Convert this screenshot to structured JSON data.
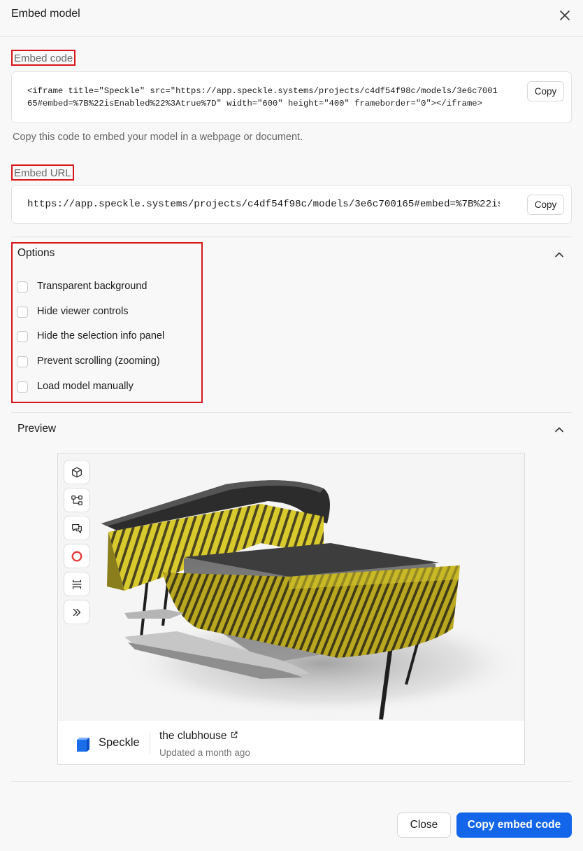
{
  "dialog": {
    "title": "Embed model"
  },
  "embed_code": {
    "label": "Embed code",
    "line1": "<iframe title=\"Speckle\" src=\"https://app.speckle.systems/projects/c4df54f98c/models/3e6c7001",
    "line2": "65#embed=%7B%22isEnabled%22%3Atrue%7D\" width=\"600\" height=\"400\" frameborder=\"0\"></iframe>",
    "copy_label": "Copy",
    "helper": "Copy this code to embed your model in a webpage or document."
  },
  "embed_url": {
    "label": "Embed URL",
    "value": "https://app.speckle.systems/projects/c4df54f98c/models/3e6c700165#embed=%7B%22is",
    "copy_label": "Copy"
  },
  "options": {
    "title": "Options",
    "items": [
      {
        "label": "Transparent background",
        "checked": false
      },
      {
        "label": "Hide viewer controls",
        "checked": false
      },
      {
        "label": "Hide the selection info panel",
        "checked": false
      },
      {
        "label": "Prevent scrolling (zooming)",
        "checked": false
      },
      {
        "label": "Load model manually",
        "checked": false
      }
    ]
  },
  "preview": {
    "title": "Preview",
    "toolbar_icons": [
      "cube-icon",
      "model-tree-icon",
      "comments-icon",
      "record-icon",
      "section-box-icon",
      "expand-chevrons-icon"
    ],
    "brand": "Speckle",
    "model_name": "the clubhouse",
    "updated": "Updated a month ago"
  },
  "footer": {
    "close_label": "Close",
    "primary_label": "Copy embed code"
  },
  "colors": {
    "accent": "#1366e9",
    "highlight": "#d5171b",
    "record": "#e83b3b",
    "louvre": "#c9b825"
  }
}
